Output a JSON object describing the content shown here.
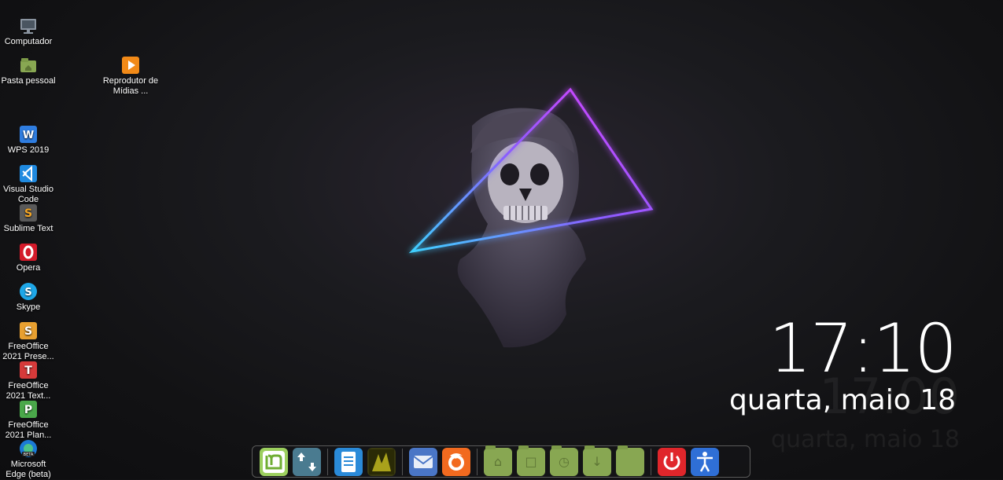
{
  "desktop": {
    "icons": [
      {
        "label": "Computador",
        "icon": "computer-icon"
      },
      {
        "label": "Pasta pessoal",
        "icon": "home-folder-icon"
      },
      {
        "label": "Reprodutor de Mídias ...",
        "icon": "media-player-icon"
      },
      {
        "label": "WPS 2019",
        "icon": "wps-icon"
      },
      {
        "label": "Visual Studio Code",
        "icon": "vscode-icon"
      },
      {
        "label": "Sublime Text",
        "icon": "sublime-icon"
      },
      {
        "label": "Opera",
        "icon": "opera-icon"
      },
      {
        "label": "Skype",
        "icon": "skype-icon"
      },
      {
        "label": "FreeOffice 2021 Prese...",
        "icon": "freeoffice-presentations-icon"
      },
      {
        "label": "FreeOffice 2021 Text...",
        "icon": "freeoffice-textmaker-icon"
      },
      {
        "label": "FreeOffice 2021 Plan...",
        "icon": "freeoffice-planmaker-icon"
      },
      {
        "label": "Microsoft Edge (beta)",
        "icon": "edge-beta-icon"
      }
    ]
  },
  "clock": {
    "time": "17:10",
    "date": "quarta, maio 18",
    "ghost_time": "17:00",
    "ghost_date": "quarta, maio 18"
  },
  "dock": {
    "apps": [
      {
        "name": "Linux Mint Menu",
        "icon": "mint-logo-icon"
      },
      {
        "name": "Update Manager",
        "icon": "update-manager-icon"
      },
      {
        "name": "Text Editor",
        "icon": "document-icon"
      },
      {
        "name": "Image",
        "icon": "image-thumbnail-icon"
      },
      {
        "name": "Mail",
        "icon": "mail-icon"
      },
      {
        "name": "Firefox",
        "icon": "firefox-icon"
      },
      {
        "name": "Home",
        "icon": "home-folder-icon"
      },
      {
        "name": "Documents",
        "icon": "documents-folder-icon"
      },
      {
        "name": "Recent",
        "icon": "recent-folder-icon"
      },
      {
        "name": "Downloads",
        "icon": "downloads-folder-icon"
      },
      {
        "name": "Folder",
        "icon": "folder-icon"
      },
      {
        "name": "Shutdown",
        "icon": "power-icon"
      },
      {
        "name": "Accessibility",
        "icon": "accessibility-icon"
      }
    ]
  },
  "colors": {
    "neon_pink": "#e040ff",
    "neon_cyan": "#3fd0ff",
    "folder_green": "#88a752",
    "power_red": "#e0262b",
    "accessibility_blue": "#2f6fd6"
  }
}
